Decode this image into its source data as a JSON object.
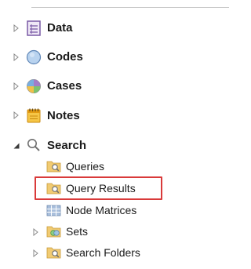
{
  "navigation": {
    "groups": [
      {
        "label": "Data",
        "icon": "data-document-icon",
        "expanded": false
      },
      {
        "label": "Codes",
        "icon": "codes-circle-icon",
        "expanded": false
      },
      {
        "label": "Cases",
        "icon": "cases-pie-icon",
        "expanded": false
      },
      {
        "label": "Notes",
        "icon": "notes-notepad-icon",
        "expanded": false
      },
      {
        "label": "Search",
        "icon": "search-magnifier-icon",
        "expanded": true
      }
    ],
    "search_children": [
      {
        "label": "Queries",
        "icon": "queries-folder-icon",
        "has_children": false
      },
      {
        "label": "Query Results",
        "icon": "query-results-folder-icon",
        "has_children": false,
        "highlighted": true
      },
      {
        "label": "Node Matrices",
        "icon": "node-matrices-folder-icon",
        "has_children": false
      },
      {
        "label": "Sets",
        "icon": "sets-folder-icon",
        "has_children": true
      },
      {
        "label": "Search Folders",
        "icon": "search-folders-icon",
        "has_children": true
      }
    ]
  },
  "colors": {
    "highlight_border": "#d93a3a",
    "codes_icon": "#a8c8ea",
    "notes_icon": "#f2b318",
    "data_icon": "#7a5aa6"
  }
}
